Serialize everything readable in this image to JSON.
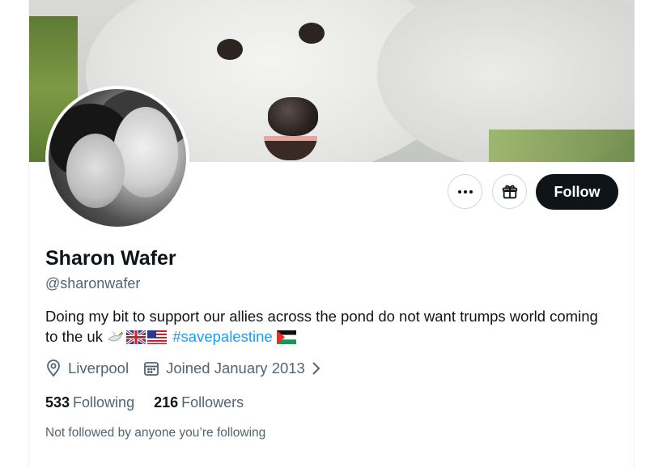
{
  "profile": {
    "name": "Sharon Wafer",
    "handle": "@sharonwafer",
    "bio_text": "Doing my bit to support our allies across the pond do not want trumps world coming to the uk",
    "bio_hashtag": "#savepalestine",
    "location": "Liverpool",
    "joined": "Joined January 2013",
    "following_count": "533",
    "following_label": "Following",
    "followers_count": "216",
    "followers_label": "Followers",
    "followed_by_note": "Not followed by anyone you’re following"
  },
  "actions": {
    "follow_label": "Follow",
    "more_icon": "ellipsis-icon",
    "gift_icon": "gift-icon"
  },
  "bio_emojis": [
    "dove-icon",
    "uk-flag-icon",
    "us-flag-icon",
    "palestine-flag-icon"
  ],
  "colors": {
    "link": "#1d9bf0",
    "follow_bg": "#0f1419",
    "secondary_text": "#536471"
  }
}
